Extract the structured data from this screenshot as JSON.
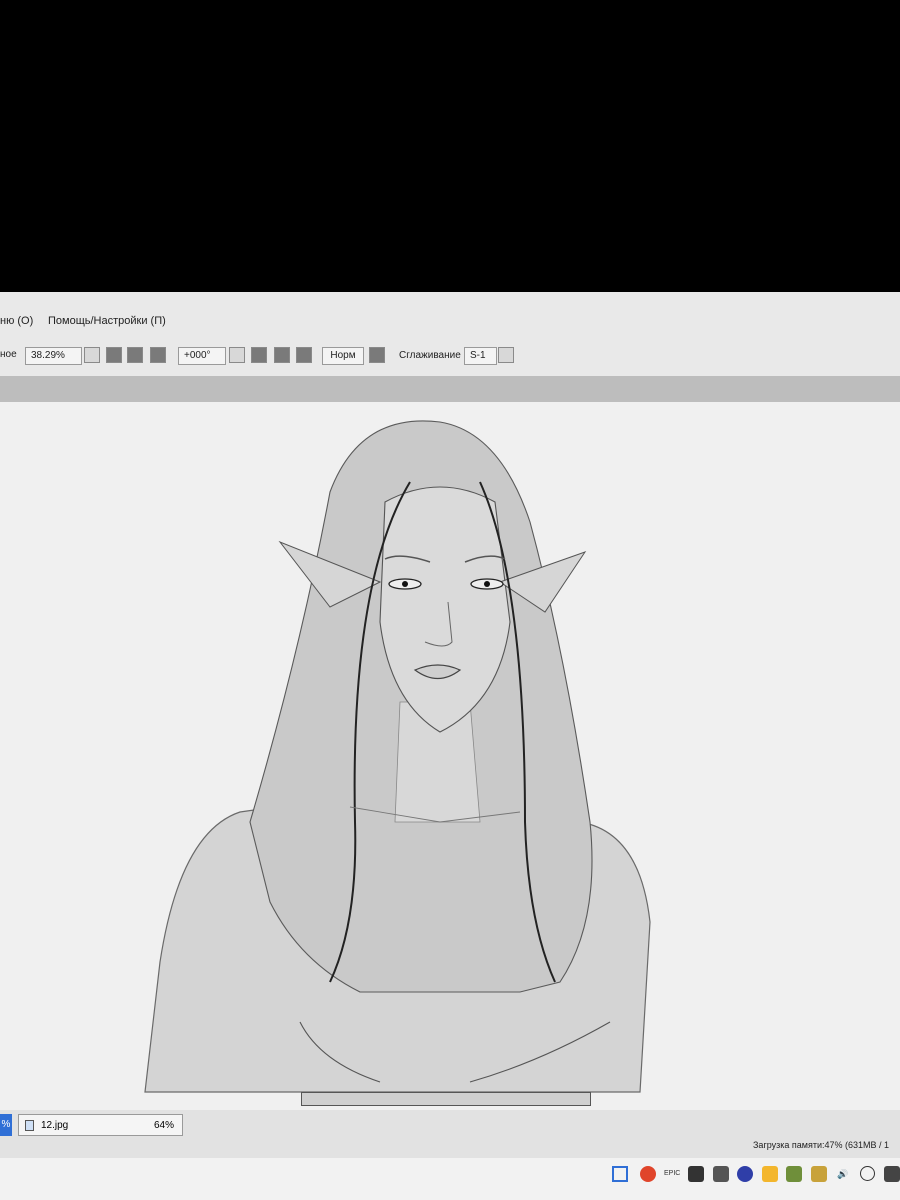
{
  "menu": {
    "item1": "ню (O)",
    "item2": "Помощь/Настройки (П)"
  },
  "toolbar": {
    "mode_partial": "ное",
    "zoom": "38.29%",
    "rotation": "+000°",
    "normal_button": "Норм",
    "smoothing_label": "Сглаживание",
    "smoothing_value": "S-1"
  },
  "statusbar": {
    "tab_prefix": "%",
    "file_name": "12.jpg",
    "file_zoom": "64%",
    "memory": "Загрузка памяти:47% (631MB / 1"
  },
  "tray": {
    "epic_label": "EPIC"
  },
  "icons": [
    "chevron-down-icon",
    "zoom-out-icon",
    "zoom-in-icon",
    "fit-icon",
    "rotate-left-icon",
    "rotate-right-icon",
    "reset-icon",
    "flip-icon",
    "file-icon"
  ],
  "colors": {
    "background": "#e9e9e9",
    "toolbar": "#f4f4f4",
    "canvas": "#f0f0f0"
  }
}
